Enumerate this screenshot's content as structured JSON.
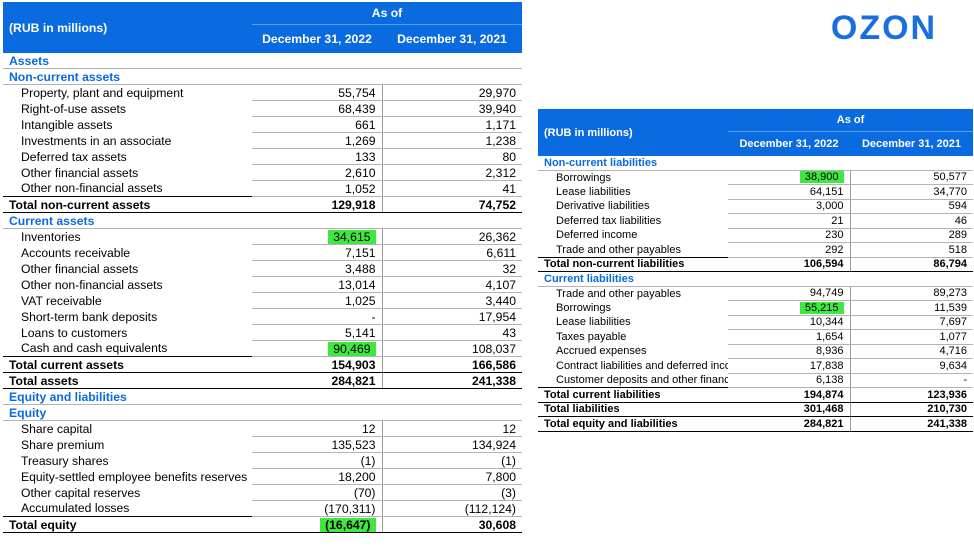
{
  "left": {
    "unit_label": "(RUB in millions)",
    "as_of": "As of",
    "col1": "December 31, 2022",
    "col2": "December 31, 2021",
    "rows": [
      {
        "type": "section",
        "label": "Assets"
      },
      {
        "type": "section",
        "label": "Non-current assets"
      },
      {
        "type": "row",
        "label": "Property, plant and equipment",
        "v1": "55,754",
        "v2": "29,970"
      },
      {
        "type": "row",
        "label": "Right-of-use assets",
        "v1": "68,439",
        "v2": "39,940"
      },
      {
        "type": "row",
        "label": "Intangible assets",
        "v1": "661",
        "v2": "1,171"
      },
      {
        "type": "row",
        "label": "Investments in an associate",
        "v1": "1,269",
        "v2": "1,238"
      },
      {
        "type": "row",
        "label": "Deferred tax assets",
        "v1": "133",
        "v2": "80"
      },
      {
        "type": "row",
        "label": "Other financial assets",
        "v1": "2,610",
        "v2": "2,312"
      },
      {
        "type": "row",
        "label": "Other non-financial assets",
        "v1": "1,052",
        "v2": "41"
      },
      {
        "type": "total",
        "label": "Total non-current assets",
        "v1": "129,918",
        "v2": "74,752"
      },
      {
        "type": "section",
        "label": "Current assets"
      },
      {
        "type": "row",
        "label": "Inventories",
        "v1": "34,615",
        "v2": "26,362",
        "hl": true
      },
      {
        "type": "row",
        "label": "Accounts receivable",
        "v1": "7,151",
        "v2": "6,611"
      },
      {
        "type": "row",
        "label": "Other financial assets",
        "v1": "3,488",
        "v2": "32"
      },
      {
        "type": "row",
        "label": "Other non-financial assets",
        "v1": "13,014",
        "v2": "4,107"
      },
      {
        "type": "row",
        "label": "VAT receivable",
        "v1": "1,025",
        "v2": "3,440"
      },
      {
        "type": "row",
        "label": "Short-term bank deposits",
        "v1": "-",
        "v2": "17,954"
      },
      {
        "type": "row",
        "label": "Loans to customers",
        "v1": "5,141",
        "v2": "43"
      },
      {
        "type": "row",
        "label": "Cash and cash equivalents",
        "v1": "90,469",
        "v2": "108,037",
        "hl": true
      },
      {
        "type": "total",
        "label": "Total current assets",
        "v1": "154,903",
        "v2": "166,586"
      },
      {
        "type": "total",
        "label": "Total assets",
        "v1": "284,821",
        "v2": "241,338"
      },
      {
        "type": "section",
        "label": "Equity and liabilities"
      },
      {
        "type": "section",
        "label": "Equity"
      },
      {
        "type": "row",
        "label": "Share capital",
        "v1": "12",
        "v2": "12"
      },
      {
        "type": "row",
        "label": "Share premium",
        "v1": "135,523",
        "v2": "134,924"
      },
      {
        "type": "row",
        "label": "Treasury shares",
        "v1": "(1)",
        "v2": "(1)"
      },
      {
        "type": "row",
        "label": "Equity-settled employee benefits reserves",
        "v1": "18,200",
        "v2": "7,800"
      },
      {
        "type": "row",
        "label": "Other capital reserves",
        "v1": "(70)",
        "v2": "(3)"
      },
      {
        "type": "row",
        "label": "Accumulated losses",
        "v1": "(170,311)",
        "v2": "(112,124)"
      },
      {
        "type": "total",
        "label": "Total equity",
        "v1": "(16,647)",
        "v2": "30,608",
        "hl": true
      }
    ]
  },
  "right": {
    "unit_label": "(RUB in millions)",
    "as_of": "As of",
    "col1": "December 31, 2022",
    "col2": "December 31, 2021",
    "rows": [
      {
        "type": "section",
        "label": "Non-current liabilities"
      },
      {
        "type": "row",
        "label": "Borrowings",
        "v1": "38,900",
        "v2": "50,577",
        "hl": true
      },
      {
        "type": "row",
        "label": "Lease liabilities",
        "v1": "64,151",
        "v2": "34,770"
      },
      {
        "type": "row",
        "label": "Derivative liabilities",
        "v1": "3,000",
        "v2": "594"
      },
      {
        "type": "row",
        "label": "Deferred tax liabilities",
        "v1": "21",
        "v2": "46"
      },
      {
        "type": "row",
        "label": "Deferred income",
        "v1": "230",
        "v2": "289"
      },
      {
        "type": "row",
        "label": "Trade and other payables",
        "v1": "292",
        "v2": "518"
      },
      {
        "type": "total",
        "label": "Total non-current liabilities",
        "v1": "106,594",
        "v2": "86,794"
      },
      {
        "type": "section",
        "label": "Current liabilities"
      },
      {
        "type": "row",
        "label": "Trade and other payables",
        "v1": "94,749",
        "v2": "89,273"
      },
      {
        "type": "row",
        "label": "Borrowings",
        "v1": "55,215",
        "v2": "11,539",
        "hl": true
      },
      {
        "type": "row",
        "label": "Lease liabilities",
        "v1": "10,344",
        "v2": "7,697"
      },
      {
        "type": "row",
        "label": "Taxes payable",
        "v1": "1,654",
        "v2": "1,077"
      },
      {
        "type": "row",
        "label": "Accrued expenses",
        "v1": "8,936",
        "v2": "4,716"
      },
      {
        "type": "row",
        "label": "Contract liabilities and deferred income",
        "v1": "17,838",
        "v2": "9,634"
      },
      {
        "type": "row",
        "label": "Customer deposits and other financial liabilities",
        "v1": "6,138",
        "v2": "-"
      },
      {
        "type": "total",
        "label": "Total current liabilities",
        "v1": "194,874",
        "v2": "123,936"
      },
      {
        "type": "total",
        "label": "Total liabilities",
        "v1": "301,468",
        "v2": "210,730"
      },
      {
        "type": "total",
        "label": "Total equity and liabilities",
        "v1": "284,821",
        "v2": "241,338"
      }
    ]
  },
  "logo_text": "OZON",
  "colors": {
    "header_blue": "#0a6ae0",
    "section_blue": "#0a6ae0",
    "highlight_green": "#3ee83e",
    "logo_blue": "#1a6fe0"
  }
}
